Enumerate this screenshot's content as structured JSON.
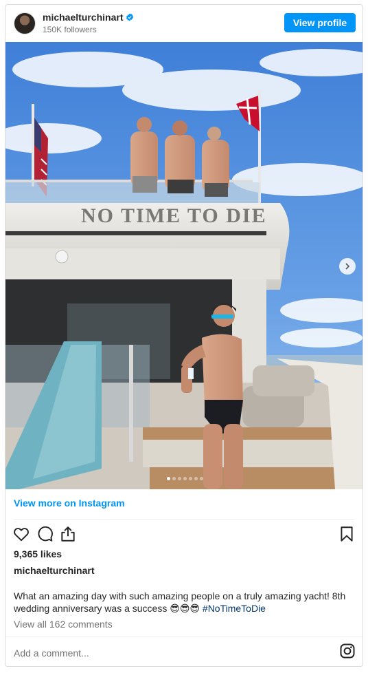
{
  "header": {
    "username": "michaelturchinart",
    "followers": "150K followers",
    "view_profile_label": "View profile"
  },
  "post": {
    "carousel": {
      "slide_count": 7,
      "active_slide": 1
    },
    "view_more_label": "View more on Instagram",
    "likes": "9,365 likes",
    "author": "michaelturchinart",
    "caption_text": "What an amazing day with such amazing people on a truly amazing yacht! 8th wedding anniversary was a success 😎😎😎",
    "caption_hashtag": "#NoTimeToDie",
    "view_comments": "View all 162 comments",
    "add_comment_placeholder": "Add a comment...",
    "yacht_name": "NO TIME TO DIE"
  },
  "icons": {
    "like": "heart-icon",
    "comment": "comment-icon",
    "share": "share-icon",
    "save": "bookmark-icon",
    "verified": "verified-badge-icon",
    "instagram": "instagram-icon",
    "next": "chevron-right-icon"
  },
  "colors": {
    "accent": "#0095f6",
    "hashtag": "#00376b",
    "muted": "#737373"
  }
}
